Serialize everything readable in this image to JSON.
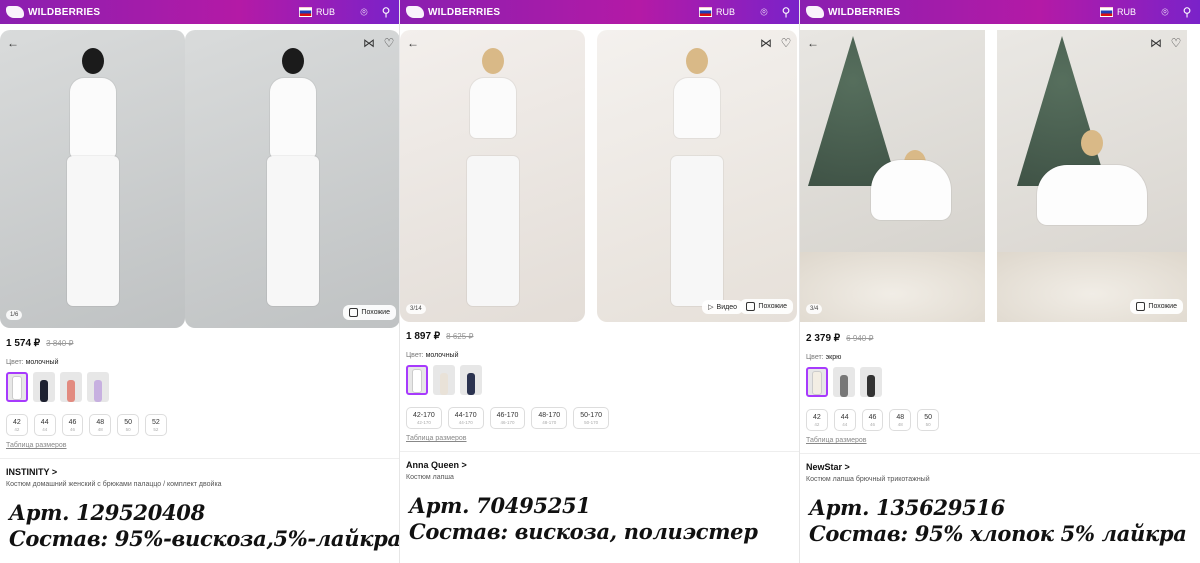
{
  "colors": {
    "brand_gradient_start": "#8a1fb0",
    "brand_gradient_end": "#7a22c9",
    "selected_swatch": "#a73afd"
  },
  "panels": [
    {
      "header": {
        "logo": "WILDBERRIES",
        "currency": "RUB"
      },
      "gallery": {
        "counter": "1/6",
        "similar": "Похожие",
        "video": ""
      },
      "price": {
        "current": "1 574 ₽",
        "old": "3 840 ₽"
      },
      "color": {
        "label": "Цвет:",
        "value": "молочный"
      },
      "swatch_count": 4,
      "sizes": [
        {
          "main": "42",
          "sub": "42"
        },
        {
          "main": "44",
          "sub": "44"
        },
        {
          "main": "46",
          "sub": "46"
        },
        {
          "main": "48",
          "sub": "48"
        },
        {
          "main": "50",
          "sub": "50"
        },
        {
          "main": "52",
          "sub": "52"
        }
      ],
      "size_table": "Таблица размеров",
      "brand": "INSTINITY >",
      "description": "Костюм домашний женский с брюками палаццо / комплект двойка",
      "caption": {
        "article": "Арт. 129520408",
        "composition": "Состав: 95%-вискоза,5%-лайкра"
      }
    },
    {
      "header": {
        "logo": "WILDBERRIES",
        "currency": "RUB"
      },
      "gallery": {
        "counter": "3/14",
        "similar": "Похожие",
        "video": "Видео"
      },
      "price": {
        "current": "1 897 ₽",
        "old": "8 625 ₽"
      },
      "color": {
        "label": "Цвет:",
        "value": "молочный"
      },
      "swatch_count": 3,
      "sizes": [
        {
          "main": "42-170",
          "sub": "42-170"
        },
        {
          "main": "44-170",
          "sub": "44-170"
        },
        {
          "main": "46-170",
          "sub": "46-170"
        },
        {
          "main": "48-170",
          "sub": "48-170"
        },
        {
          "main": "50-170",
          "sub": "50-170"
        }
      ],
      "size_table": "Таблица размеров",
      "brand": "Anna Queen >",
      "description": "Костюм лапша",
      "caption": {
        "article": "Арт. 70495251",
        "composition": "Состав: вискоза, полиэстер"
      }
    },
    {
      "header": {
        "logo": "WILDBERRIES",
        "currency": "RUB"
      },
      "gallery": {
        "counter": "3/4",
        "similar": "Похожие",
        "video": ""
      },
      "price": {
        "current": "2 379 ₽",
        "old": "6 940 ₽"
      },
      "color": {
        "label": "Цвет:",
        "value": "экрю"
      },
      "swatch_count": 3,
      "sizes": [
        {
          "main": "42",
          "sub": "42"
        },
        {
          "main": "44",
          "sub": "44"
        },
        {
          "main": "46",
          "sub": "46"
        },
        {
          "main": "48",
          "sub": "48"
        },
        {
          "main": "50",
          "sub": "50"
        }
      ],
      "size_table": "Таблица размеров",
      "brand": "NewStar >",
      "description": "Костюм лапша брючный трикотажный",
      "caption": {
        "article": "Арт. 135629516",
        "composition": "Состав: 95% хлопок 5% лайкра"
      }
    }
  ]
}
